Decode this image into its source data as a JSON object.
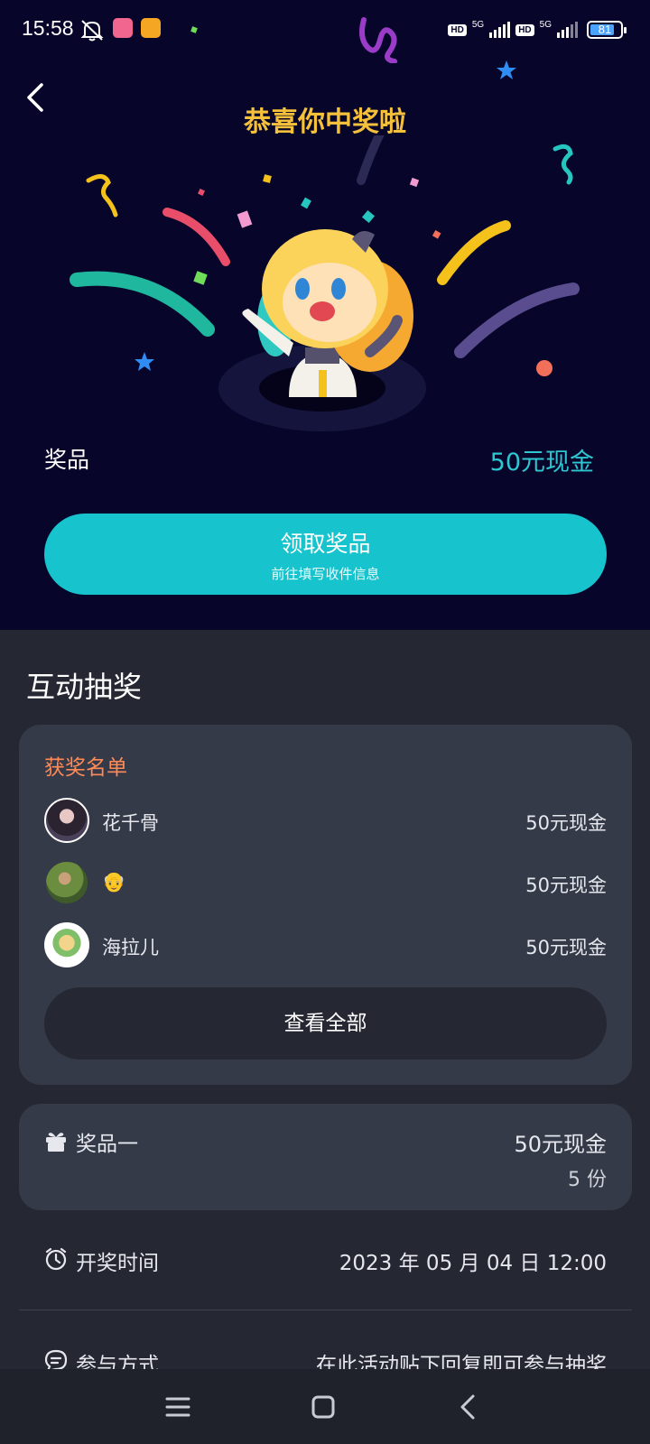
{
  "status_bar": {
    "time": "15:58",
    "hd_1": "HD",
    "net_1": "5G",
    "hd_2": "HD",
    "net_2": "5G",
    "battery": "81",
    "battery_level": 0.81
  },
  "header": {
    "title": "恭喜你中奖啦",
    "back_icon": "chevron-left-icon"
  },
  "prize": {
    "label": "奖品",
    "value": "50元现金"
  },
  "claim_button": {
    "label": "领取奖品",
    "sublabel": "前往填写收件信息"
  },
  "section": {
    "title": "互动抽奖"
  },
  "winners": {
    "title": "获奖名单",
    "items": [
      {
        "name": "花千骨",
        "prize": "50元现金"
      },
      {
        "name": "👴",
        "prize": "50元现金"
      },
      {
        "name": "海拉儿",
        "prize": "50元现金"
      }
    ],
    "view_all_label": "查看全部"
  },
  "prize_card": {
    "name": "奖品一",
    "value": "50元现金",
    "count": "5 份"
  },
  "draw_info": {
    "time_label": "开奖时间",
    "time_value": "2023 年 05 月 04 日 12:00",
    "method_label": "参与方式",
    "method_value": "在此活动贴下回复即可参与抽奖"
  },
  "colors": {
    "hero_bg": "#07062a",
    "page_bg": "#252833",
    "card_bg": "#353a48",
    "accent_teal": "#17c3cc",
    "title_gold": "#f6c13a",
    "winners_orange": "#ff8a57"
  },
  "nav_bar": {
    "icons": [
      "menu-icon",
      "home-icon",
      "back-icon"
    ]
  }
}
